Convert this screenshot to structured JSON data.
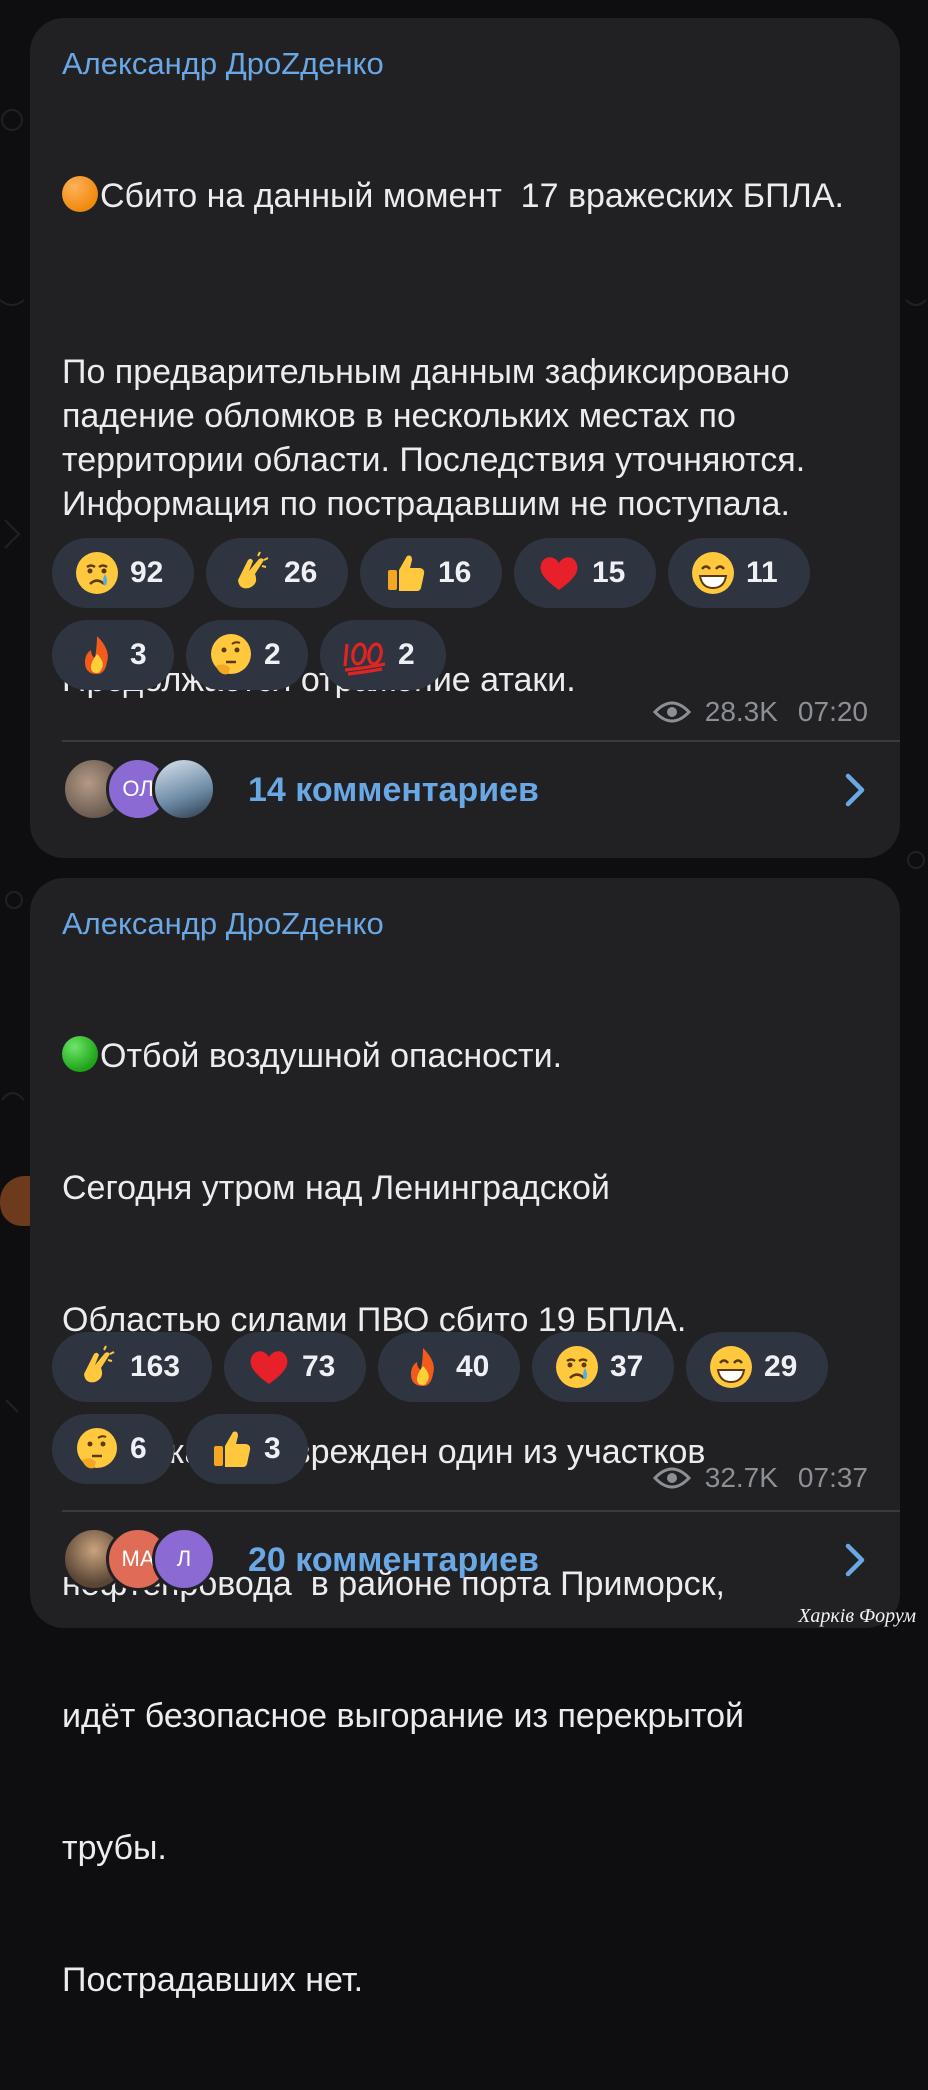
{
  "posts": [
    {
      "author": "Александр ДроZденко",
      "paragraphs": [
        "Сбито на данный момент  17 вражеских БПЛА.",
        "По предварительным данным зафиксировано падение обломков в нескольких местах по территории области. Последствия уточняются. Информация по пострадавшим не поступала.",
        "Продолжается отражение атаки."
      ],
      "status_dot_color": "#f08a0e",
      "reactions": [
        {
          "icon": "crying-face-icon",
          "count": "92"
        },
        {
          "icon": "clapping-hands-icon",
          "count": "26"
        },
        {
          "icon": "thumbs-up-icon",
          "count": "16"
        },
        {
          "icon": "red-heart-icon",
          "count": "15"
        },
        {
          "icon": "grinning-face-icon",
          "count": "11"
        },
        {
          "icon": "fire-icon",
          "count": "3"
        },
        {
          "icon": "thinking-face-icon",
          "count": "2"
        },
        {
          "icon": "hundred-points-icon",
          "count": "2"
        }
      ],
      "views": "28.3K",
      "time": "07:20",
      "avatars": [
        "",
        "ОЛ",
        ""
      ],
      "comments_label": "14 комментариев"
    },
    {
      "author": "Александр ДроZденко",
      "lines": [
        "Отбой воздушной опасности.",
        "Сегодня утром над Ленинградской",
        "Областью силами ПВО сбито 19 БПЛА.",
        "Обломками поврежден один из участков",
        "нефтепровода  в районе порта Приморск,",
        "идёт безопасное выгорание из перекрытой",
        "трубы.",
        "Пострадавших нет."
      ],
      "status_dot_color": "#1fa319",
      "reactions": [
        {
          "icon": "clapping-hands-icon",
          "count": "163"
        },
        {
          "icon": "red-heart-icon",
          "count": "73"
        },
        {
          "icon": "fire-icon",
          "count": "40"
        },
        {
          "icon": "crying-face-icon",
          "count": "37"
        },
        {
          "icon": "grinning-face-icon",
          "count": "29"
        },
        {
          "icon": "thinking-face-icon",
          "count": "6"
        },
        {
          "icon": "thumbs-up-icon",
          "count": "3"
        }
      ],
      "views": "32.7K",
      "time": "07:37",
      "avatars": [
        "",
        "МА",
        "Л"
      ],
      "comments_label": "20 комментариев"
    }
  ],
  "watermark": "Харків Форум",
  "colors": {
    "accent": "#6aa7e5",
    "bubble": "#212123",
    "chip": "#2e3440",
    "highlight": "#be5f28"
  }
}
